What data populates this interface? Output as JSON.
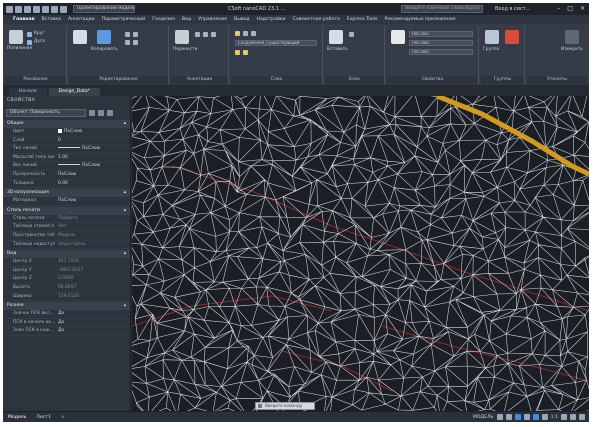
{
  "title_bar": {
    "workspace": "Проектирование модели",
    "title": "CSoft nanoCAD 23.1 ...",
    "search_placeholder": "Введите ключевое слово/фразу",
    "user": "Вход в сист..."
  },
  "menu": {
    "items": [
      "Главная",
      "Вставка",
      "Аннотации",
      "Параметрический",
      "Геодезия",
      "Вид",
      "Управление",
      "Вывод",
      "Надстройки",
      "Совместная работа",
      "Express Tools",
      "Рекомендуемые приложения"
    ],
    "active_index": 0
  },
  "ribbon": {
    "groups": [
      {
        "name": "Рисование"
      },
      {
        "name": "Редактирование"
      },
      {
        "name": "Аннотации"
      },
      {
        "name": "Слои"
      },
      {
        "name": "Блок"
      },
      {
        "name": "Свойства"
      },
      {
        "name": "Группы"
      },
      {
        "name": "Утилиты"
      }
    ],
    "labels": {
      "polyline": "Полилиния",
      "circle": "Круг",
      "arc": "Дуга",
      "move": "Перенести",
      "copy": "Копировать",
      "text": "Текст",
      "dim": "Размер",
      "layer_props": "Свойства слоя",
      "insert": "Вставить",
      "match": "Копировать свойства",
      "group": "Группа",
      "measure": "Измерить"
    },
    "layer_dropdown": "Сооружения_Существующий",
    "by_layer_1": "ПоСлою",
    "by_layer_2": "ПоСлою",
    "by_layer_3": "ПоСлою"
  },
  "tabs": [
    {
      "label": "Начало",
      "active": false
    },
    {
      "label": "Design_Data*",
      "active": true
    }
  ],
  "properties": {
    "title": "СВОЙСТВА",
    "selection": "Объект: Поверхность",
    "sections": [
      {
        "name": "Общие",
        "rows": [
          {
            "k": "Цвет",
            "v": "ПоСлою",
            "swatch": true
          },
          {
            "k": "Слой",
            "v": "0"
          },
          {
            "k": "Тип линий",
            "v": "ПоСлою",
            "line": true
          },
          {
            "k": "Масштаб типа лин...",
            "v": "1.00"
          },
          {
            "k": "Вес линий",
            "v": "ПоСлою",
            "line": true
          },
          {
            "k": "Прозрачность",
            "v": "ПоСлою"
          },
          {
            "k": "Толщина",
            "v": "0.00"
          }
        ]
      },
      {
        "name": "3D-визуализация",
        "rows": [
          {
            "k": "Материал",
            "v": "ПоСлою"
          }
        ]
      },
      {
        "name": "Стиль печати",
        "rows": [
          {
            "k": "Стиль печати",
            "v": "ПоЦвету",
            "dim": true
          },
          {
            "k": "Таблица стилей п...",
            "v": "Нет",
            "dim": true
          },
          {
            "k": "Пространство таб...",
            "v": "Модель",
            "dim": true
          },
          {
            "k": "Таблица недоступ...",
            "v": "Недоступно",
            "dim": true
          }
        ]
      },
      {
        "name": "Вид",
        "rows": [
          {
            "k": "Центр X",
            "v": "467.1556",
            "dim": true
          },
          {
            "k": "Центр Y",
            "v": "-4803.8217",
            "dim": true
          },
          {
            "k": "Центр Z",
            "v": "0.0000",
            "dim": true
          },
          {
            "k": "Высота",
            "v": "98.8697",
            "dim": true
          },
          {
            "k": "Ширина",
            "v": "119.6520",
            "dim": true
          }
        ]
      },
      {
        "name": "Разное",
        "rows": [
          {
            "k": "Значок ПСК вкл...",
            "v": "Да"
          },
          {
            "k": "ПСК в начале ко...",
            "v": "Да"
          },
          {
            "k": "Знак ПСК в каж...",
            "v": "Да"
          }
        ]
      }
    ]
  },
  "command_line": {
    "placeholder": "Введите команду"
  },
  "status_bar": {
    "layouts": [
      "Модель",
      "Лист1",
      "+"
    ],
    "model_label": "МОДЕЛЬ",
    "scale": "1:1"
  }
}
